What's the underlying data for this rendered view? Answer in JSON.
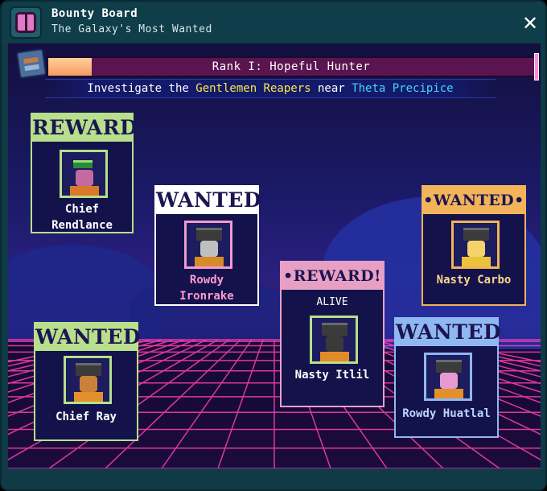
{
  "window": {
    "title": "Bounty Board",
    "subtitle": "The Galaxy's Most Wanted",
    "close_symbol": "✕"
  },
  "rank": {
    "label": "Rank I: Hopeful Hunter",
    "progress": 0.09
  },
  "objective": {
    "prefix": "Investigate the",
    "faction": "Gentlemen Reapers",
    "middle": "near",
    "location": "Theta Precipice"
  },
  "cards": [
    {
      "header": "REWARD",
      "subtitle": "",
      "name_line1": "Chief",
      "name_line2": "Rendlance",
      "color": "#b7df8c"
    },
    {
      "header": "WANTED",
      "subtitle": "",
      "name_line1": "Rowdy",
      "name_line2": "Ironrake",
      "color": "#ffffff"
    },
    {
      "header": "•WANTED•",
      "subtitle": "",
      "name_line1": "Nasty Carbo",
      "name_line2": "",
      "color": "#f2b35a"
    },
    {
      "header": "•REWARD!•",
      "subtitle": "ALIVE",
      "name_line1": "Nasty Itlil",
      "name_line2": "",
      "color": "#e7a0c4"
    },
    {
      "header": "WANTED",
      "subtitle": "",
      "name_line1": "Chief Ray",
      "name_line2": "",
      "color": "#b7df8c"
    },
    {
      "header": "WANTED",
      "subtitle": "",
      "name_line1": "Rowdy Huatlal",
      "name_line2": "",
      "color": "#8fb7f2"
    }
  ],
  "colors": {
    "accent_pink": "#ff4fb8",
    "highlight_yellow": "#ffe94a",
    "highlight_cyan": "#3fd7ff"
  }
}
